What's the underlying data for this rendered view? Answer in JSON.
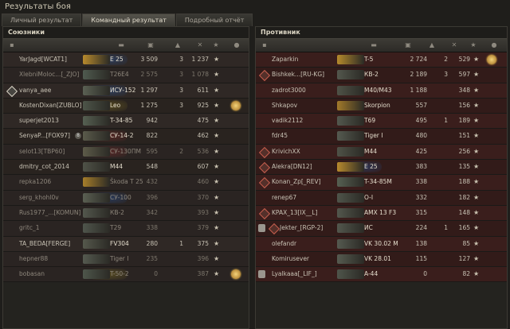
{
  "window": {
    "title": "Результаты боя"
  },
  "tabs": [
    "Личный результат",
    "Командный результат",
    "Подробный отчёт"
  ],
  "allies": {
    "title": "Союзники",
    "rows": [
      {
        "player": "YarJagd[WCAT1]",
        "tank": "E 25",
        "damage": "3 509",
        "kills": "3",
        "xp": "1 237",
        "hl": "#2a4f8c",
        "img": "#b78a2d",
        "me": true
      },
      {
        "player": "XlebniMoloc...[_ZJO]",
        "tank": "T26E4",
        "damage": "2 575",
        "kills": "3",
        "xp": "1 078",
        "img": "#4f5a4f",
        "dead": true
      },
      {
        "player": "vanya_aee",
        "tank": "ИСУ-152",
        "damage": "1 297",
        "kills": "3",
        "xp": "611",
        "hl": "#2a4f8c",
        "img": "#5a6053",
        "squad": true
      },
      {
        "player": "KostenDixan[ZUBLO]",
        "tank": "Leo",
        "damage": "1 275",
        "kills": "3",
        "xp": "925",
        "hl": "#7b6b23",
        "img": "#4d5549",
        "medal": true
      },
      {
        "player": "superjet2013",
        "tank": "T-34-85",
        "damage": "942",
        "kills": "",
        "xp": "475",
        "img": "#566052"
      },
      {
        "player": "SenyaP...[FOX97]",
        "tank": "СУ-14-2",
        "damage": "822",
        "kills": "",
        "xp": "462",
        "hl": "#7e2d2d",
        "img": "#5a5a4b",
        "badge": "8"
      },
      {
        "player": "selot13[TBP60]",
        "tank": "СУ-130ПМ",
        "damage": "595",
        "kills": "2",
        "xp": "536",
        "hl": "#7e2d2d",
        "img": "#5d5b49",
        "dead": true
      },
      {
        "player": "dmitry_cot_2014",
        "tank": "M44",
        "damage": "548",
        "kills": "",
        "xp": "607",
        "img": "#4f5247"
      },
      {
        "player": "repka1206",
        "tank": "Škoda T 25",
        "damage": "432",
        "kills": "",
        "xp": "460",
        "img": "#a67e2a",
        "dead": true
      },
      {
        "player": "serg_khohl0v",
        "tank": "СУ-100",
        "damage": "396",
        "kills": "",
        "xp": "370",
        "hl": "#2a4f8c",
        "img": "#5a5f52",
        "dead": true
      },
      {
        "player": "Rus1977_...[KOMUN]",
        "tank": "КВ-2",
        "damage": "342",
        "kills": "",
        "xp": "393",
        "img": "#53574d",
        "dead": true
      },
      {
        "player": "gritc_1",
        "tank": "T29",
        "damage": "338",
        "kills": "",
        "xp": "379",
        "img": "#4f554c",
        "dead": true
      },
      {
        "player": "TA_BEDA[FERGE]",
        "tank": "FV304",
        "damage": "280",
        "kills": "1",
        "xp": "375",
        "img": "#55584c"
      },
      {
        "player": "hepner88",
        "tank": "Tiger I",
        "damage": "235",
        "kills": "",
        "xp": "396",
        "img": "#555a50",
        "dead": true
      },
      {
        "player": "bobasan",
        "tank": "T-50-2",
        "damage": "0",
        "kills": "",
        "xp": "387",
        "hl": "#7b6b23",
        "img": "#4e564b",
        "dead": true,
        "medal": true
      }
    ]
  },
  "enemies": {
    "title": "Противник",
    "rows": [
      {
        "player": "Zaparkin",
        "tank": "T-5",
        "damage": "2 724",
        "kills": "2",
        "xp": "529",
        "img": "#b58a2c",
        "medal": true
      },
      {
        "player": "Bishkek...[RU-KG]",
        "tank": "КВ-2",
        "damage": "2 189",
        "kills": "3",
        "xp": "597",
        "img": "#53574d",
        "squad": true
      },
      {
        "player": "zadrot3000",
        "tank": "M40/M43",
        "damage": "1 188",
        "kills": "",
        "xp": "348",
        "img": "#4f5247"
      },
      {
        "player": "Shkapov",
        "tank": "Skorpion",
        "damage": "557",
        "kills": "",
        "xp": "156",
        "img": "#a27a2a"
      },
      {
        "player": "vadik2112",
        "tank": "T69",
        "damage": "495",
        "kills": "1",
        "xp": "189",
        "img": "#53584e"
      },
      {
        "player": "fdr45",
        "tank": "Tiger I",
        "damage": "480",
        "kills": "",
        "xp": "151",
        "img": "#555a50"
      },
      {
        "player": "KrivichXX",
        "tank": "M44",
        "damage": "425",
        "kills": "",
        "xp": "256",
        "img": "#4f5247",
        "squad": true
      },
      {
        "player": "Alekra[DN12]",
        "tank": "E 25",
        "damage": "383",
        "kills": "",
        "xp": "135",
        "hl": "#2a4f8c",
        "img": "#b78a2d",
        "squad": true
      },
      {
        "player": "Konan_Zp[_REV]",
        "tank": "T-34-85M",
        "damage": "338",
        "kills": "",
        "xp": "188",
        "img": "#566052",
        "squad": true
      },
      {
        "player": "renep67",
        "tank": "O-I",
        "damage": "332",
        "kills": "",
        "xp": "182",
        "img": "#4f544a"
      },
      {
        "player": "KPAX_13[IX__L]",
        "tank": "AMX 13 F3",
        "damage": "315",
        "kills": "",
        "xp": "148",
        "img": "#53574d",
        "squad": true
      },
      {
        "player": "Jekter_[RGP-2]",
        "tank": "ИС",
        "damage": "224",
        "kills": "1",
        "xp": "165",
        "img": "#53574d",
        "squad": true,
        "lock": true
      },
      {
        "player": "olefandr",
        "tank": "VK 30.02 M",
        "damage": "138",
        "kills": "",
        "xp": "85",
        "img": "#555a50"
      },
      {
        "player": "Komirusever",
        "tank": "VK 28.01",
        "damage": "115",
        "kills": "",
        "xp": "127",
        "img": "#565b50"
      },
      {
        "player": "Lyalkaaa[_LIF_]",
        "tank": "A-44",
        "damage": "0",
        "kills": "",
        "xp": "82",
        "img": "#4f554b",
        "lock": true
      }
    ]
  },
  "header_icons": [
    "squad-icon",
    "tank-class-icon",
    "tank-icon",
    "damage-icon",
    "kills-icon",
    "xp-icon",
    "player-icon"
  ],
  "star": "★"
}
